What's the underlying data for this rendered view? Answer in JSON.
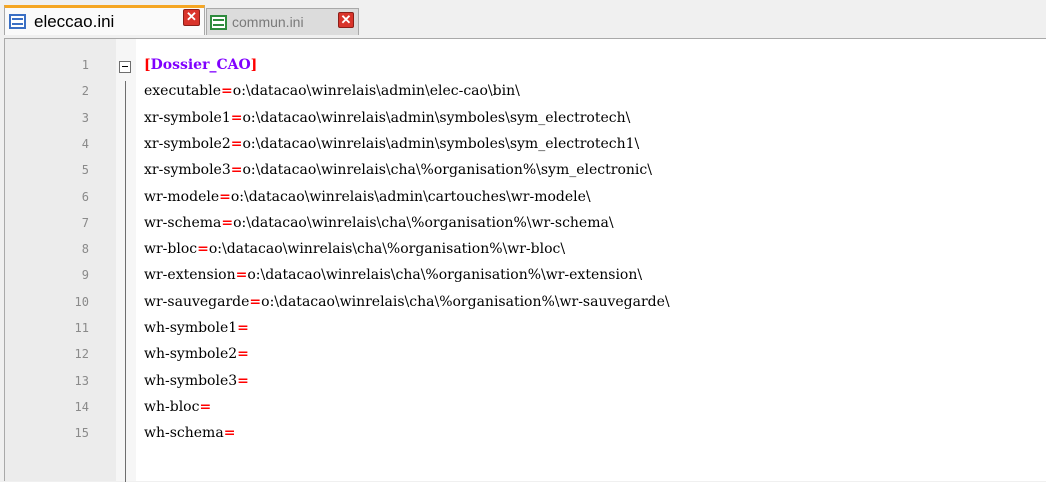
{
  "tabs": [
    {
      "label": "eleccao.ini",
      "active": true,
      "icon": "file-icon",
      "close_glyph": "✕"
    },
    {
      "label": "commun.ini",
      "active": false,
      "icon": "file-icon-modified",
      "close_glyph": "✕"
    }
  ],
  "colors": {
    "section": "#8000ff",
    "operator": "#ff0000",
    "active_tab_accent": "#f5a623",
    "line_number": "#8a8a8a"
  },
  "lines": [
    {
      "num": "1",
      "type": "section",
      "open": "[",
      "name": "Dossier_CAO",
      "close": "]"
    },
    {
      "num": "2",
      "type": "kv",
      "key": "executable",
      "eq": "=",
      "value": "o:\\datacao\\winrelais\\admin\\elec-cao\\bin\\"
    },
    {
      "num": "3",
      "type": "kv",
      "key": "xr-symbole1",
      "eq": "=",
      "value": "o:\\datacao\\winrelais\\admin\\symboles\\sym_electrotech\\"
    },
    {
      "num": "4",
      "type": "kv",
      "key": "xr-symbole2",
      "eq": "=",
      "value": "o:\\datacao\\winrelais\\admin\\symboles\\sym_electrotech1\\"
    },
    {
      "num": "5",
      "type": "kv",
      "key": "xr-symbole3",
      "eq": "=",
      "value": "o:\\datacao\\winrelais\\cha\\%organisation%\\sym_electronic\\"
    },
    {
      "num": "6",
      "type": "kv",
      "key": "wr-modele",
      "eq": "=",
      "value": "o:\\datacao\\winrelais\\admin\\cartouches\\wr-modele\\"
    },
    {
      "num": "7",
      "type": "kv",
      "key": "wr-schema",
      "eq": "=",
      "value": "o:\\datacao\\winrelais\\cha\\%organisation%\\wr-schema\\"
    },
    {
      "num": "8",
      "type": "kv",
      "key": "wr-bloc",
      "eq": "=",
      "value": "o:\\datacao\\winrelais\\cha\\%organisation%\\wr-bloc\\"
    },
    {
      "num": "9",
      "type": "kv",
      "key": "wr-extension",
      "eq": "=",
      "value": "o:\\datacao\\winrelais\\cha\\%organisation%\\wr-extension\\"
    },
    {
      "num": "10",
      "type": "kv",
      "key": "wr-sauvegarde",
      "eq": "=",
      "value": "o:\\datacao\\winrelais\\cha\\%organisation%\\wr-sauvegarde\\"
    },
    {
      "num": "11",
      "type": "kv",
      "key": "wh-symbole1",
      "eq": "=",
      "value": ""
    },
    {
      "num": "12",
      "type": "kv",
      "key": "wh-symbole2",
      "eq": "=",
      "value": ""
    },
    {
      "num": "13",
      "type": "kv",
      "key": "wh-symbole3",
      "eq": "=",
      "value": ""
    },
    {
      "num": "14",
      "type": "kv",
      "key": "wh-bloc",
      "eq": "=",
      "value": ""
    },
    {
      "num": "15",
      "type": "kv",
      "key": "wh-schema",
      "eq": "=",
      "value": ""
    }
  ]
}
